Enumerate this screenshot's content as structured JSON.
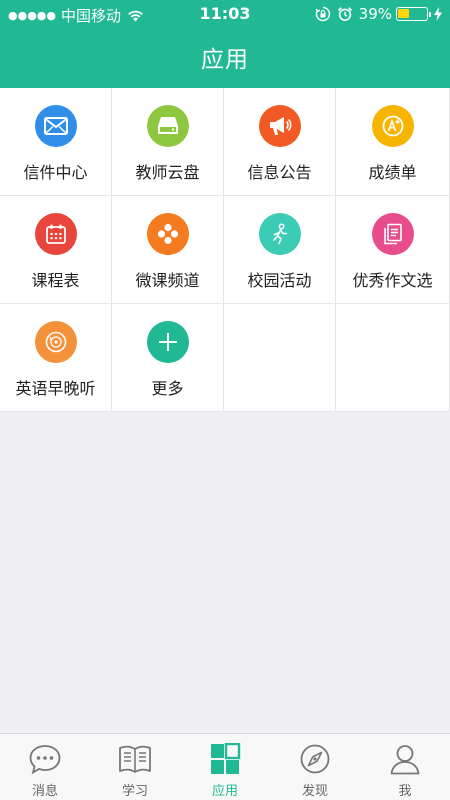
{
  "status_bar": {
    "signal": "●●●●●",
    "carrier": "中国移动",
    "time": "11:03",
    "battery_percent": "39%",
    "battery_level": 0.39,
    "battery_color": "#ffd60a"
  },
  "header": {
    "title": "应用",
    "background_color": "#20b994"
  },
  "apps": [
    {
      "label": "信件中心",
      "icon": "mail-icon",
      "color": "#2f8fe8"
    },
    {
      "label": "教师云盘",
      "icon": "cloud-disk-icon",
      "color": "#8dc63f"
    },
    {
      "label": "信息公告",
      "icon": "megaphone-icon",
      "color": "#f15a24"
    },
    {
      "label": "成绩单",
      "icon": "grade-icon",
      "color": "#f7b500"
    },
    {
      "label": "课程表",
      "icon": "calendar-icon",
      "color": "#e8453c"
    },
    {
      "label": "微课频道",
      "icon": "channel-icon",
      "color": "#f47b20"
    },
    {
      "label": "校园活动",
      "icon": "running-icon",
      "color": "#3ccbb4"
    },
    {
      "label": "优秀作文选",
      "icon": "essay-icon",
      "color": "#e84c8b"
    },
    {
      "label": "英语早晚听",
      "icon": "disc-icon",
      "color": "#f5913b"
    },
    {
      "label": "更多",
      "icon": "plus-icon",
      "color": "#20b994"
    }
  ],
  "tabbar": {
    "items": [
      {
        "label": "消息",
        "icon": "chat-icon",
        "active": false
      },
      {
        "label": "学习",
        "icon": "book-icon",
        "active": false
      },
      {
        "label": "应用",
        "icon": "apps-grid-icon",
        "active": true
      },
      {
        "label": "发现",
        "icon": "compass-icon",
        "active": false
      },
      {
        "label": "我",
        "icon": "user-icon",
        "active": false
      }
    ],
    "active_color": "#20b994",
    "inactive_color": "#888888"
  }
}
